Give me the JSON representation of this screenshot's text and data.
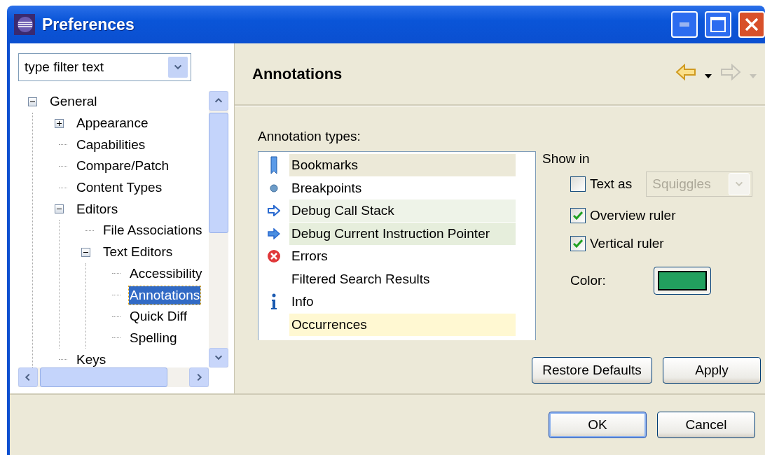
{
  "window": {
    "title": "Preferences"
  },
  "filter": {
    "placeholder": "type filter text"
  },
  "tree": [
    {
      "label": "General",
      "selected": false,
      "expanded": true,
      "children": [
        {
          "label": "Appearance",
          "selected": false,
          "expanded": false
        },
        {
          "label": "Capabilities",
          "selected": false
        },
        {
          "label": "Compare/Patch",
          "selected": false
        },
        {
          "label": "Content Types",
          "selected": false
        },
        {
          "label": "Editors",
          "selected": false,
          "expanded": true,
          "children": [
            {
              "label": "File Associations",
              "selected": false
            },
            {
              "label": "Text Editors",
              "selected": false,
              "expanded": true,
              "children": [
                {
                  "label": "Accessibility",
                  "selected": false
                },
                {
                  "label": "Annotations",
                  "selected": true
                },
                {
                  "label": "Quick Diff",
                  "selected": false
                },
                {
                  "label": "Spelling",
                  "selected": false
                }
              ]
            }
          ]
        },
        {
          "label": "Keys",
          "selected": false
        }
      ]
    }
  ],
  "page": {
    "title": "Annotations",
    "back": {
      "disabled": false
    },
    "forward": {
      "disabled": true
    }
  },
  "annotation_types": {
    "label": "Annotation types:",
    "items": [
      {
        "kind": "bookmark",
        "label": "Bookmarks",
        "color": "#ece9d8"
      },
      {
        "kind": "breakpoint",
        "label": "Breakpoints"
      },
      {
        "kind": "stack",
        "label": "Debug Call Stack",
        "color": "#eef3e8"
      },
      {
        "kind": "pointer",
        "label": "Debug Current Instruction Pointer",
        "color": "#e6eedc"
      },
      {
        "kind": "error",
        "label": "Errors"
      },
      {
        "kind": "plain",
        "label": "Filtered Search Results"
      },
      {
        "kind": "info",
        "label": "Info"
      },
      {
        "kind": "plain",
        "label": "Occurrences",
        "color": "#fff8d2"
      }
    ]
  },
  "show_in": {
    "label": "Show in",
    "options": [
      {
        "kind": "combo",
        "label": "Text as",
        "checked": false,
        "combo": {
          "value": "Squiggles",
          "disabled": true
        }
      },
      {
        "kind": "plain",
        "label": "Overview ruler",
        "checked": true
      },
      {
        "kind": "plain",
        "label": "Vertical ruler",
        "checked": true
      }
    ]
  },
  "color_setting": {
    "label": "Color:",
    "color": "#22a05e"
  },
  "page_buttons": [
    "Restore Defaults",
    "Apply"
  ],
  "dialog_buttons": [
    {
      "label": "OK",
      "default": true
    },
    {
      "label": "Cancel",
      "default": false
    }
  ]
}
